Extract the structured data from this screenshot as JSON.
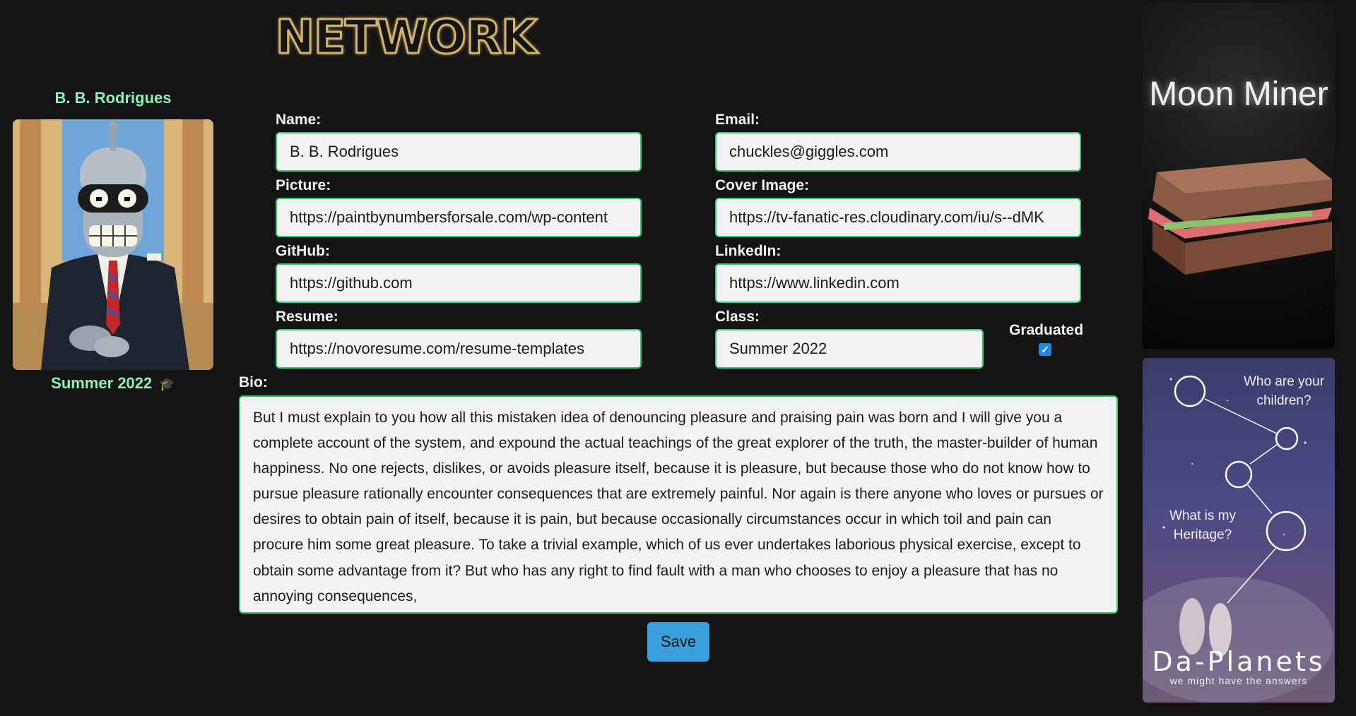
{
  "header": {
    "logo_text": "NETWORK"
  },
  "profile": {
    "name": "B. B. Rodrigues",
    "class": "Summer 2022",
    "graduated_icon": "graduation-cap-icon"
  },
  "form": {
    "name": {
      "label": "Name:",
      "value": "B. B. Rodrigues"
    },
    "email": {
      "label": "Email:",
      "value": "chuckles@giggles.com"
    },
    "picture": {
      "label": "Picture:",
      "value": "https://paintbynumbersforsale.com/wp-content"
    },
    "cover": {
      "label": "Cover Image:",
      "value": "https://tv-fanatic-res.cloudinary.com/iu/s--dMK"
    },
    "github": {
      "label": "GitHub:",
      "value": "https://github.com"
    },
    "linkedin": {
      "label": "LinkedIn:",
      "value": "https://www.linkedin.com"
    },
    "resume": {
      "label": "Resume:",
      "value": "https://novoresume.com/resume-templates"
    },
    "class": {
      "label": "Class:",
      "value": "Summer 2022"
    },
    "graduated": {
      "label": "Graduated",
      "checked": true
    },
    "bio": {
      "label": "Bio:",
      "value": "But I must explain to you how all this mistaken idea of denouncing pleasure and praising pain was born and I will give you a complete account of the system, and expound the actual teachings of the great explorer of the truth, the master-builder of human happiness. No one rejects, dislikes, or avoids pleasure itself, because it is pleasure, but because those who do not know how to pursue pleasure rationally encounter consequences that are extremely painful. Nor again is there anyone who loves or pursues or desires to obtain pain of itself, because it is pain, but because occasionally circumstances occur in which toil and pain can procure him some great pleasure. To take a trivial example, which of us ever undertakes laborious physical exercise, except to obtain some advantage from it? But who has any right to find fault with a man who chooses to enjoy a pleasure that has no annoying consequences,"
    },
    "save_label": "Save"
  },
  "ads": {
    "moon_miner": {
      "title": "Moon Miner"
    },
    "da_planets": {
      "q1": "Who are your children?",
      "q2": "What is my Heritage?",
      "brand": "Da-Planets",
      "tagline": "we might have the answers"
    }
  },
  "colors": {
    "background": "#141414",
    "accent_green": "#2bd06b",
    "name_green": "#8ef0b8",
    "save_blue": "#3aa0dc"
  }
}
